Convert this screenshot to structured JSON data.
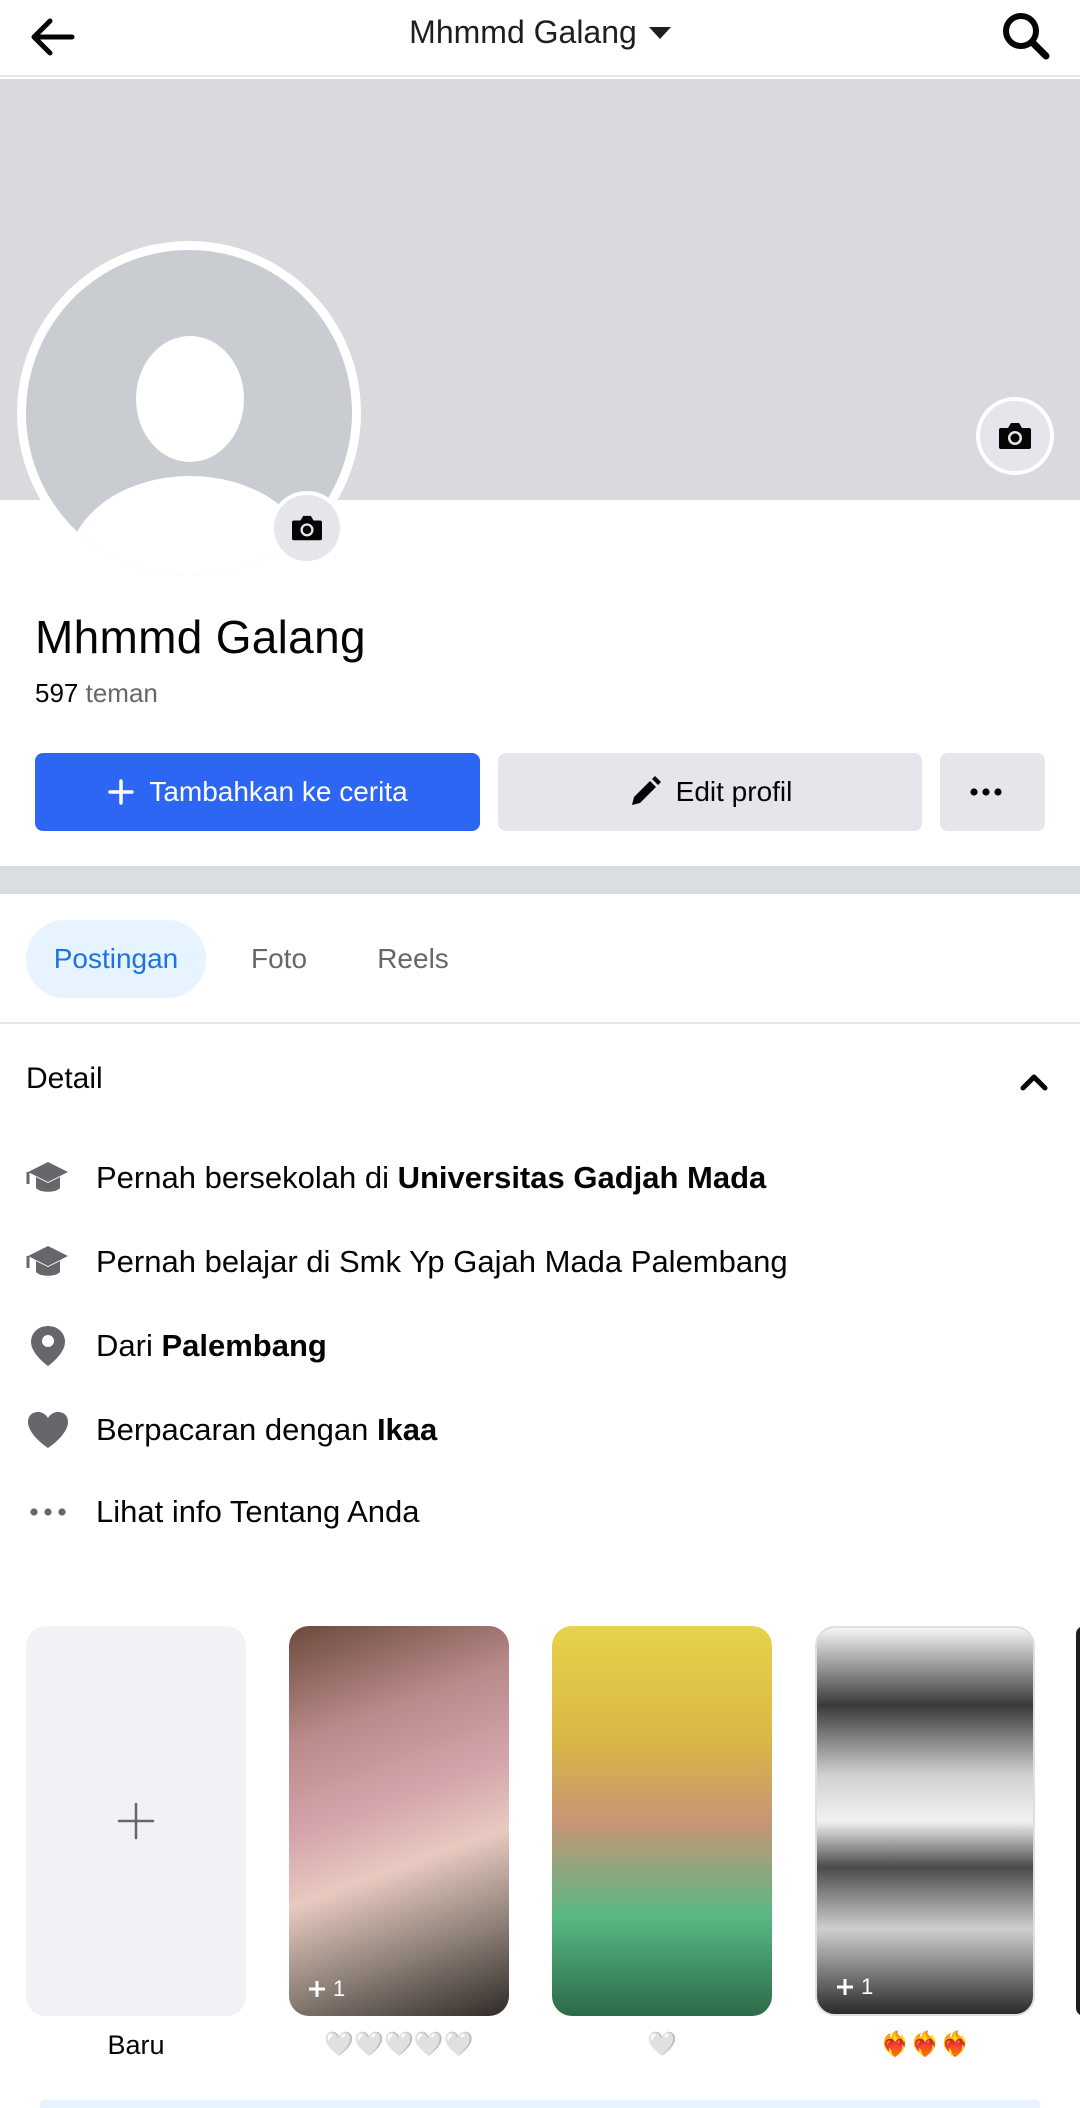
{
  "header": {
    "title": "Mhmmd Galang",
    "back_icon": "arrow-left-icon",
    "search_icon": "search-icon",
    "dropdown_icon": "caret-down-icon"
  },
  "profile": {
    "name": "Mhmmd Galang",
    "friends_count": "597",
    "friends_label": "teman"
  },
  "actions": {
    "add_story_label": "Tambahkan ke cerita",
    "edit_profile_label": "Edit profil",
    "more_icon": "more-horizontal-icon"
  },
  "tabs": [
    {
      "label": "Postingan",
      "active": true
    },
    {
      "label": "Foto",
      "active": false
    },
    {
      "label": "Reels",
      "active": false
    }
  ],
  "details": {
    "title": "Detail",
    "items": [
      {
        "icon": "graduation-cap-icon",
        "prefix": "Pernah bersekolah di ",
        "bold": "Universitas Gadjah Mada"
      },
      {
        "icon": "graduation-cap-icon",
        "prefix": "Pernah belajar di Smk Yp Gajah Mada Palembang",
        "bold": ""
      },
      {
        "icon": "location-pin-icon",
        "prefix": "Dari ",
        "bold": "Palembang"
      },
      {
        "icon": "heart-icon",
        "prefix": "Berpacaran dengan ",
        "bold": "Ikaa"
      },
      {
        "icon": "more-horizontal-icon",
        "prefix": "Lihat info Tentang Anda",
        "bold": ""
      }
    ]
  },
  "stories": {
    "new_label": "Baru",
    "items": [
      {
        "badge": "1",
        "caption": "🤍🤍🤍🤍🤍"
      },
      {
        "badge": "",
        "caption": "🤍"
      },
      {
        "badge": "1",
        "caption": "❤️‍🔥❤️‍🔥❤️‍🔥"
      }
    ]
  },
  "colors": {
    "primary": "#2d66f2",
    "tab_active_bg": "#e7f3ff",
    "tab_active_text": "#1b74e4",
    "cover": "#d9dade"
  }
}
